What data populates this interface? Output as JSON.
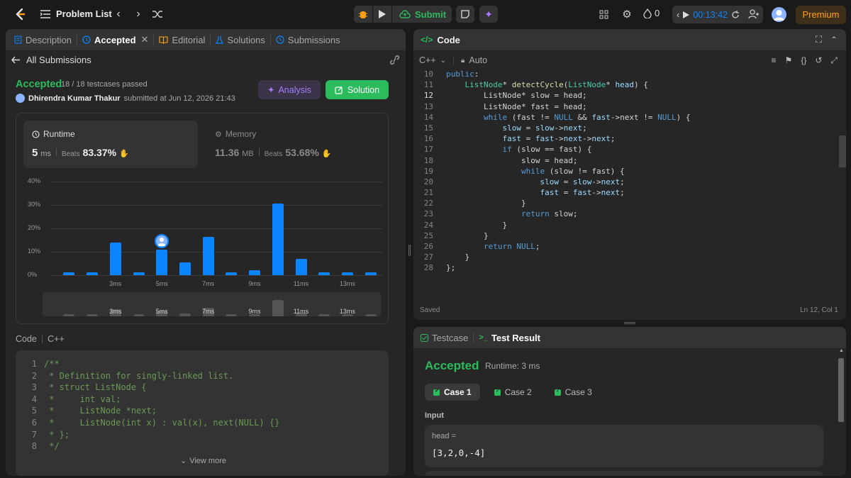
{
  "header": {
    "problem_list": "Problem List",
    "submit": "Submit",
    "streak": "0",
    "timer": "00:13:42",
    "premium": "Premium"
  },
  "left_tabs": [
    "Description",
    "Accepted",
    "Editorial",
    "Solutions",
    "Submissions"
  ],
  "submission": {
    "back_label": "All Submissions",
    "status": "Accepted",
    "testcases": "18 / 18 testcases passed",
    "author": "Dhirendra Kumar Thakur",
    "submitted_at": "submitted at Jun 12, 2026 21:43",
    "analysis_label": "Analysis",
    "solution_label": "Solution",
    "runtime": {
      "label": "Runtime",
      "value": "5",
      "unit": "ms",
      "beats_label": "Beats",
      "beats": "83.37%"
    },
    "memory": {
      "label": "Memory",
      "value": "11.36",
      "unit": "MB",
      "beats_label": "Beats",
      "beats": "53.68%"
    }
  },
  "chart_data": {
    "type": "bar",
    "yticks": [
      "40%",
      "30%",
      "20%",
      "10%",
      "0%"
    ],
    "ylim": [
      0,
      40
    ],
    "xtick_labels": [
      "3ms",
      "5ms",
      "7ms",
      "9ms",
      "11ms",
      "13ms"
    ],
    "values": [
      1.2,
      1.2,
      14,
      1.2,
      11,
      5.5,
      16.3,
      1.2,
      2,
      30.5,
      7,
      1.2,
      1.2,
      1.2
    ],
    "highlight_index": 4
  },
  "left_code": {
    "header": "Code",
    "language": "C++",
    "lines": [
      "/**",
      " * Definition for singly-linked list.",
      " * struct ListNode {",
      " *     int val;",
      " *     ListNode *next;",
      " *     ListNode(int x) : val(x), next(NULL) {}",
      " * };",
      " */"
    ],
    "view_more": "View more"
  },
  "editor": {
    "title": "Code",
    "language": "C++",
    "mode": "Auto",
    "saved": "Saved",
    "position": "Ln 12, Col 1"
  },
  "result": {
    "tab_testcase": "Testcase",
    "tab_result": "Test Result",
    "status": "Accepted",
    "runtime": "Runtime: 3 ms",
    "cases": [
      "Case 1",
      "Case 2",
      "Case 3"
    ],
    "input_label": "Input",
    "param_name": "head =",
    "param_value": "[3,2,0,-4]"
  },
  "colors": {
    "accent_green": "#2cbb5d",
    "accent_blue": "#0a84ff",
    "premium": "#ffa116"
  }
}
